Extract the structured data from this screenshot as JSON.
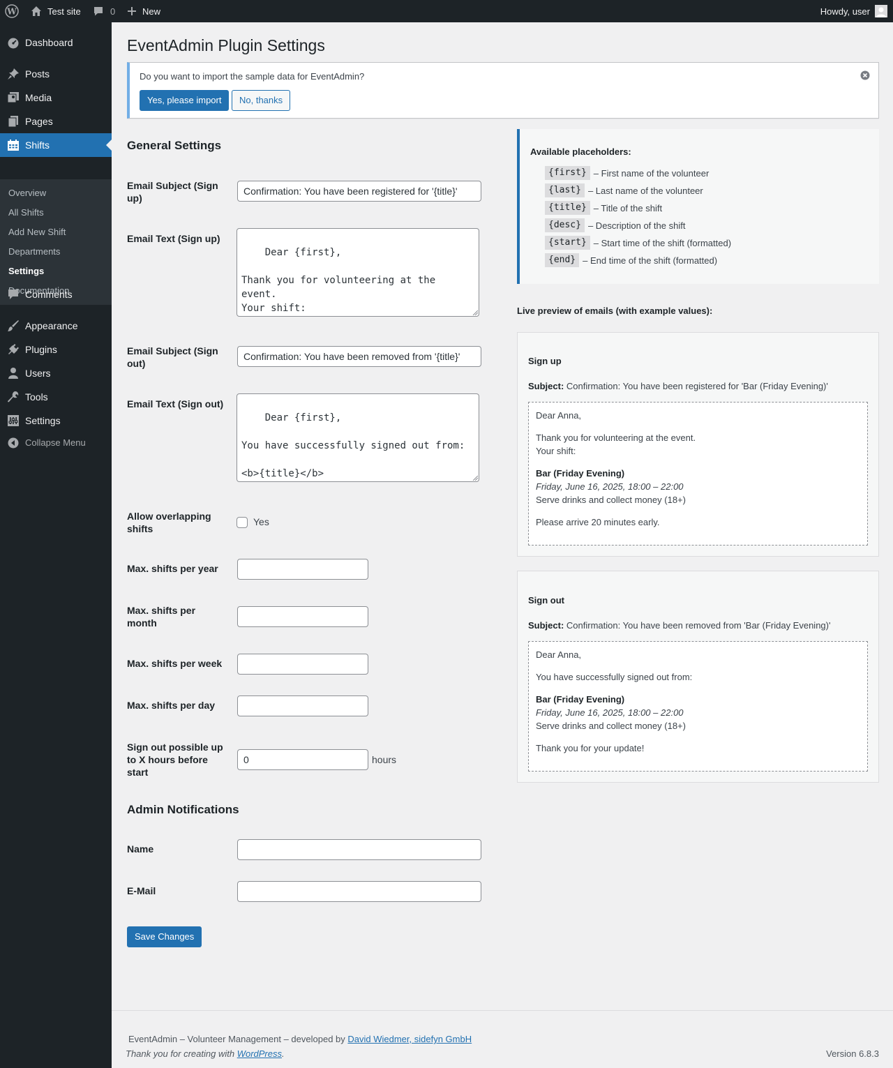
{
  "adminbar": {
    "site_name": "Test site",
    "comments_count": "0",
    "new_label": "New",
    "howdy": "Howdy, user"
  },
  "sidebar": {
    "items": [
      {
        "label": "Dashboard",
        "icon": "dashboard-icon"
      },
      {
        "label": "Posts",
        "icon": "pin-icon"
      },
      {
        "label": "Media",
        "icon": "media-icon"
      },
      {
        "label": "Pages",
        "icon": "pages-icon"
      },
      {
        "label": "Shifts",
        "icon": "calendar-icon"
      },
      {
        "label": "Comments",
        "icon": "comment-icon"
      },
      {
        "label": "Appearance",
        "icon": "brush-icon"
      },
      {
        "label": "Plugins",
        "icon": "plug-icon"
      },
      {
        "label": "Users",
        "icon": "user-icon"
      },
      {
        "label": "Tools",
        "icon": "wrench-icon"
      },
      {
        "label": "Settings",
        "icon": "settings-icon"
      },
      {
        "label": "Collapse Menu",
        "icon": "collapse-icon"
      }
    ],
    "submenu": [
      "Overview",
      "All Shifts",
      "Add New Shift",
      "Departments",
      "Settings",
      "Documentation"
    ]
  },
  "page": {
    "title": "EventAdmin Plugin Settings"
  },
  "notice": {
    "text": "Do you want to import the sample data for EventAdmin?",
    "yes_label": "Yes, please import",
    "no_label": "No, thanks"
  },
  "general": {
    "heading": "General Settings",
    "subject_signup_label": "Email Subject (Sign up)",
    "subject_signup_value": "Confirmation: You have been registered for '{title}'",
    "text_signup_label": "Email Text (Sign up)",
    "text_signup_value": "Dear {first},\n\nThank you for volunteering at the event.\nYour shift:",
    "subject_signout_label": "Email Subject (Sign out)",
    "subject_signout_value": "Confirmation: You have been removed from '{title}'",
    "text_signout_label": "Email Text (Sign out)",
    "text_signout_value": "Dear {first},\n\nYou have successfully signed out from:\n\n<b>{title}</b>\n<i>{start} – {end}</i>",
    "overlap_label": "Allow overlapping shifts",
    "overlap_option": "Yes",
    "overlap_checked": false,
    "max_year_label": "Max. shifts per year",
    "max_year_value": "",
    "max_month_label": "Max. shifts per month",
    "max_month_value": "",
    "max_week_label": "Max. shifts per week",
    "max_week_value": "",
    "max_day_label": "Max. shifts per day",
    "max_day_value": "",
    "signout_hours_label": "Sign out possible up to X hours before start",
    "signout_hours_value": "0",
    "hours_unit": "hours"
  },
  "admin_notifications": {
    "heading": "Admin Notifications",
    "name_label": "Name",
    "name_value": "",
    "email_label": "E-Mail",
    "email_value": ""
  },
  "save_label": "Save Changes",
  "placeholders": {
    "heading": "Available placeholders:",
    "items": [
      {
        "code": "{first}",
        "desc": "– First name of the volunteer"
      },
      {
        "code": "{last}",
        "desc": "– Last name of the volunteer"
      },
      {
        "code": "{title}",
        "desc": "– Title of the shift"
      },
      {
        "code": "{desc}",
        "desc": "– Description of the shift"
      },
      {
        "code": "{start}",
        "desc": "– Start time of the shift (formatted)"
      },
      {
        "code": "{end}",
        "desc": "– End time of the shift (formatted)"
      }
    ]
  },
  "preview": {
    "heading": "Live preview of emails (with example values):",
    "subject_label": "Subject:",
    "signup": {
      "title": "Sign up",
      "subject": "Confirmation: You have been registered for 'Bar (Friday Evening)'",
      "greeting": "Dear Anna,",
      "line1": "Thank you for volunteering at the event.",
      "line2": "Your shift:",
      "shift_title": "Bar (Friday Evening)",
      "shift_time": "Friday, June 16, 2025, 18:00 – 22:00",
      "shift_desc": "Serve drinks and collect money (18+)",
      "closing": "Please arrive 20 minutes early."
    },
    "signout": {
      "title": "Sign out",
      "subject": "Confirmation: You have been removed from 'Bar (Friday Evening)'",
      "greeting": "Dear Anna,",
      "line1": "You have successfully signed out from:",
      "shift_title": "Bar (Friday Evening)",
      "shift_time": "Friday, June 16, 2025, 18:00 – 22:00",
      "shift_desc": "Serve drinks and collect money (18+)",
      "closing": "Thank you for your update!"
    }
  },
  "footer": {
    "credit_prefix": "EventAdmin – Volunteer Management – developed by",
    "credit_link": "David Wiedmer, sidefyn GmbH",
    "thanks_prefix": "Thank you for creating with",
    "thanks_link": "WordPress",
    "thanks_suffix": ".",
    "version": "Version 6.8.3"
  }
}
